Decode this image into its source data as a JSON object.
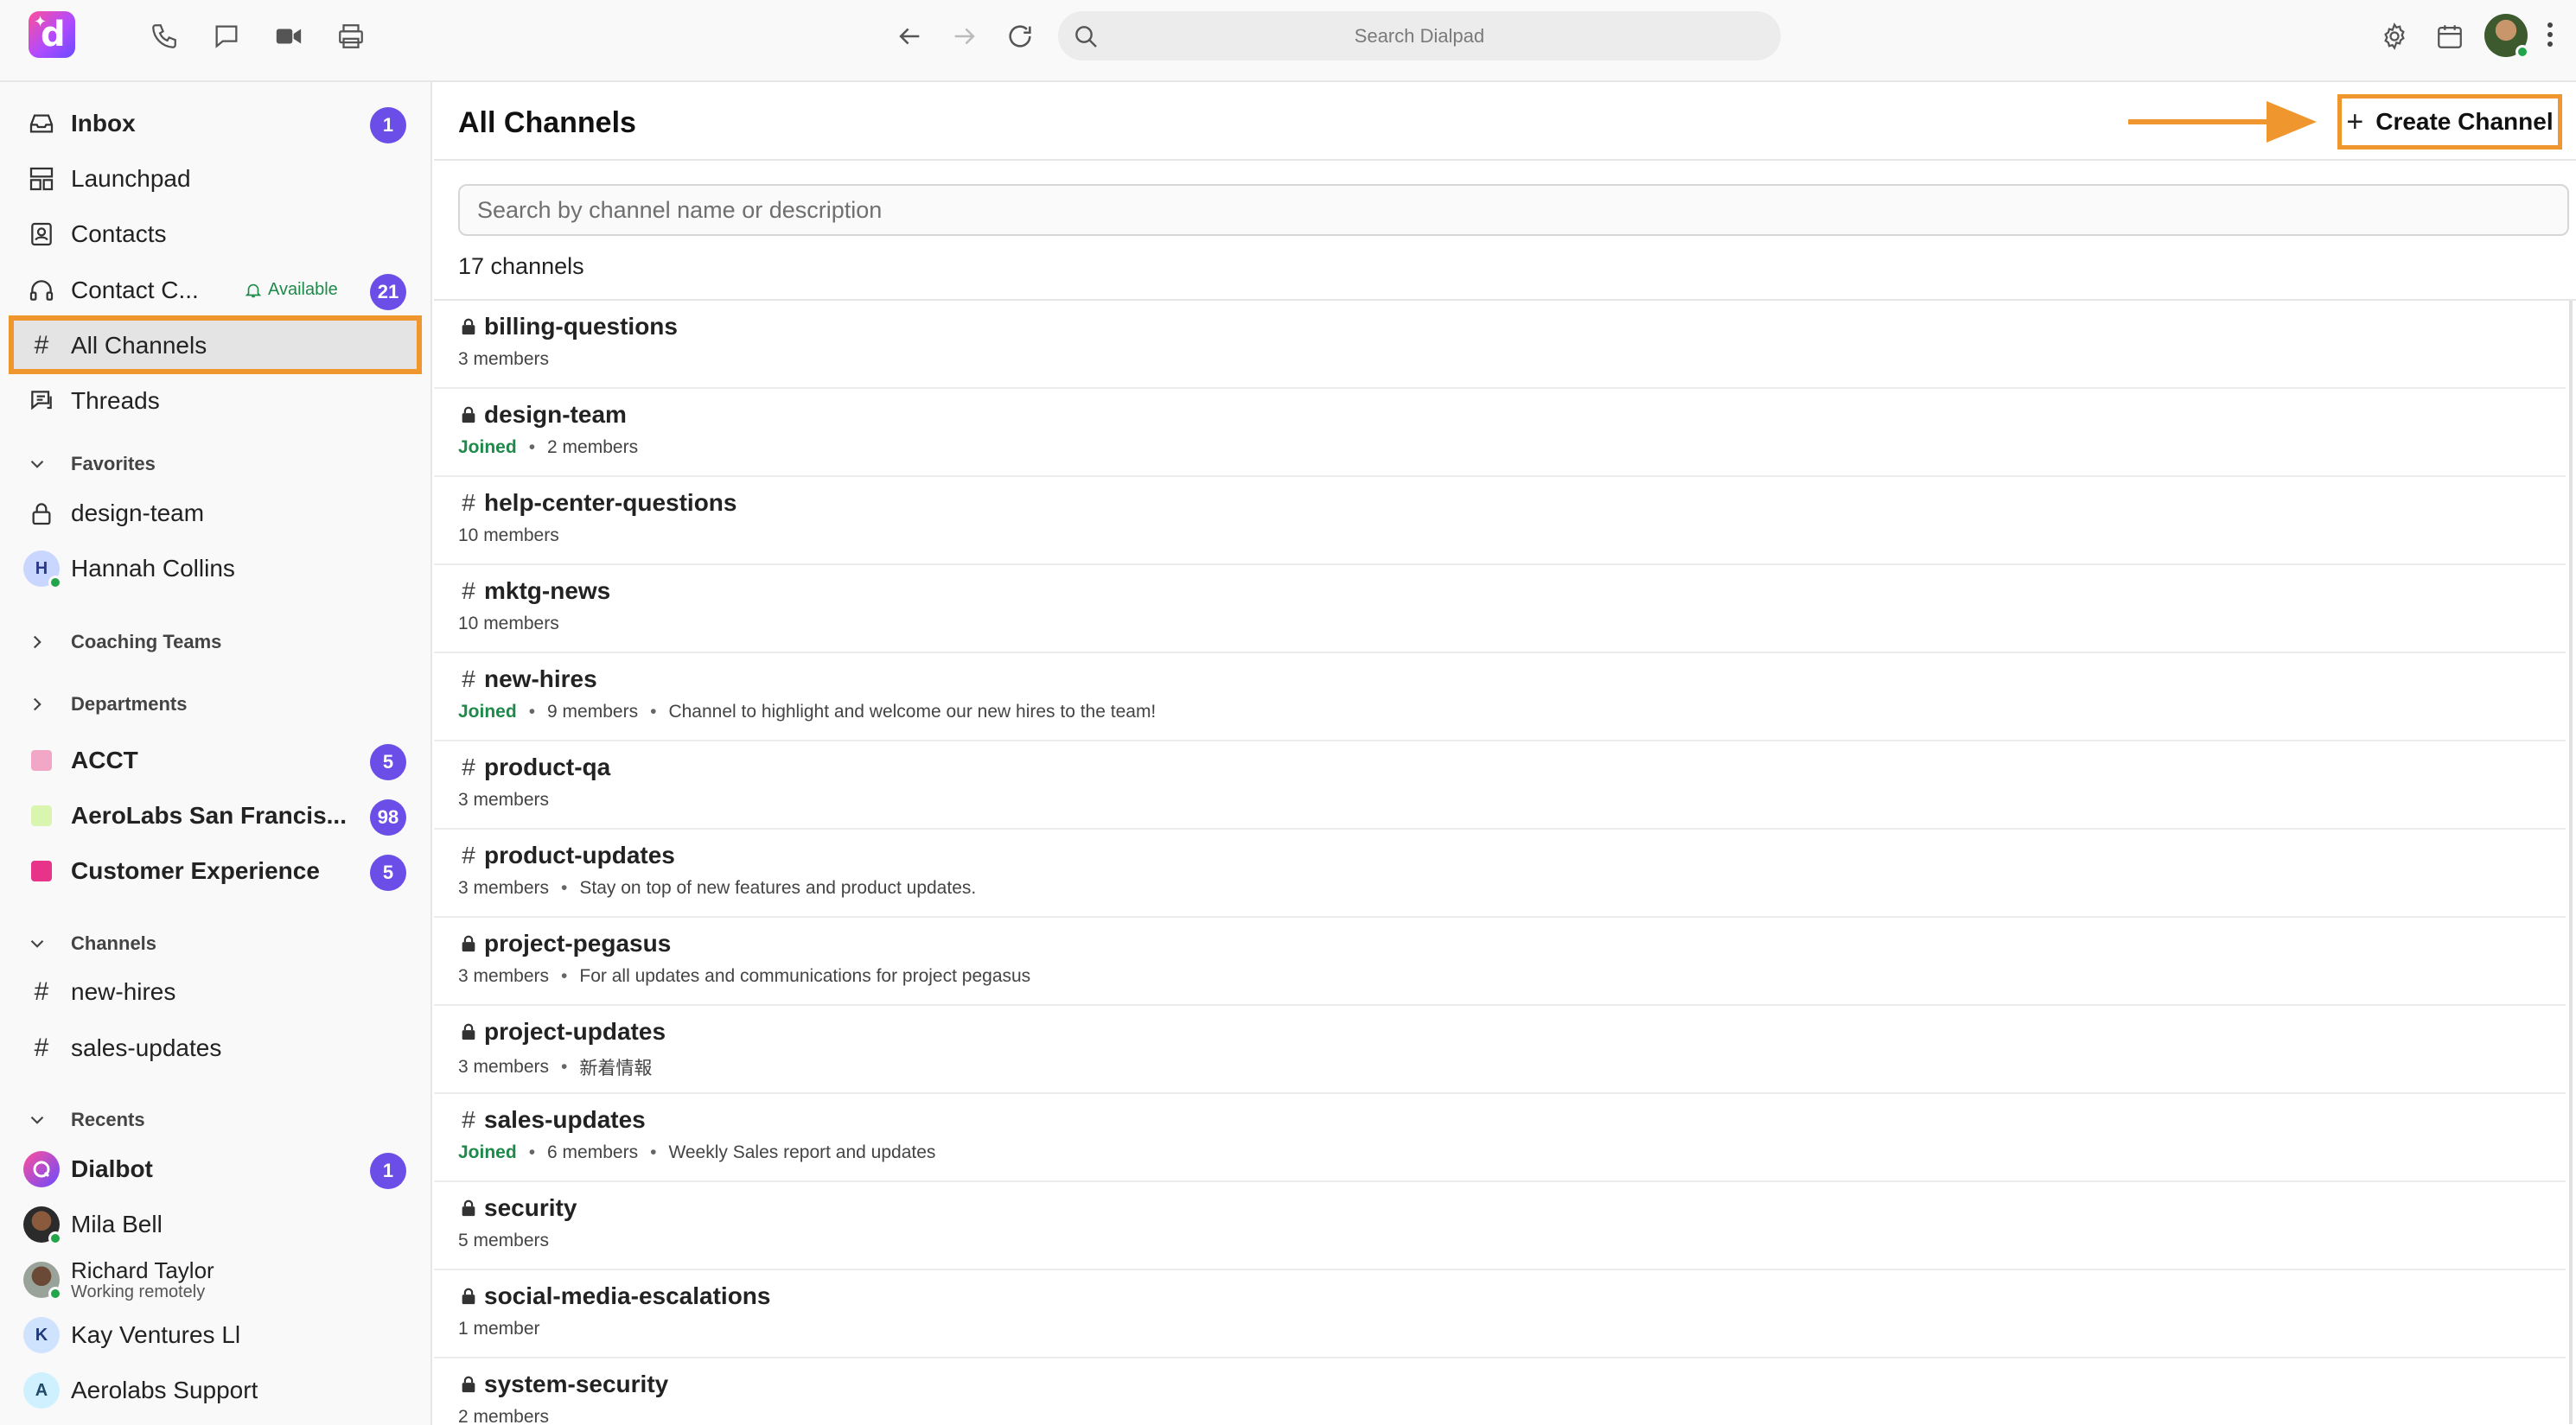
{
  "topbar": {
    "search_placeholder": "Search Dialpad",
    "logo_letter": "d"
  },
  "sidebar": {
    "inbox": {
      "label": "Inbox",
      "badge": "1"
    },
    "launchpad": {
      "label": "Launchpad"
    },
    "contacts": {
      "label": "Contacts"
    },
    "contact_center": {
      "label": "Contact C...",
      "status": "Available",
      "badge": "21"
    },
    "all_channels": {
      "label": "All Channels"
    },
    "threads": {
      "label": "Threads"
    },
    "favorites": {
      "heading": "Favorites",
      "items": [
        {
          "label": "design-team"
        },
        {
          "label": "Hannah Collins",
          "initial": "H"
        }
      ]
    },
    "coaching_teams": {
      "heading": "Coaching Teams"
    },
    "departments": {
      "heading": "Departments",
      "items": [
        {
          "label": "ACCT",
          "badge": "5",
          "color": "#f2a7c6"
        },
        {
          "label": "AeroLabs San Francis...",
          "badge": "98",
          "color": "#d9f5b0"
        },
        {
          "label": "Customer Experience",
          "badge": "5",
          "color": "#e8338a"
        }
      ]
    },
    "channels": {
      "heading": "Channels",
      "items": [
        {
          "label": "new-hires"
        },
        {
          "label": "sales-updates"
        }
      ]
    },
    "recents": {
      "heading": "Recents",
      "items": [
        {
          "label": "Dialbot",
          "badge": "1"
        },
        {
          "label": "Mila Bell"
        },
        {
          "label": "Richard Taylor",
          "sublabel": "Working remotely"
        },
        {
          "label": "Kay Ventures Ll",
          "initial": "K"
        },
        {
          "label": "Aerolabs Support",
          "initial": "A"
        }
      ]
    }
  },
  "main": {
    "title": "All Channels",
    "create_label": "Create Channel",
    "search_placeholder": "Search by channel name or description",
    "count_label": "17 channels",
    "channels": [
      {
        "name": "billing-questions",
        "private": true,
        "joined": false,
        "members": "3 members",
        "description": ""
      },
      {
        "name": "design-team",
        "private": true,
        "joined": true,
        "members": "2 members",
        "description": ""
      },
      {
        "name": "help-center-questions",
        "private": false,
        "joined": false,
        "members": "10 members",
        "description": ""
      },
      {
        "name": "mktg-news",
        "private": false,
        "joined": false,
        "members": "10 members",
        "description": ""
      },
      {
        "name": "new-hires",
        "private": false,
        "joined": true,
        "members": "9 members",
        "description": "Channel to highlight and welcome our new hires to the team!"
      },
      {
        "name": "product-qa",
        "private": false,
        "joined": false,
        "members": "3 members",
        "description": ""
      },
      {
        "name": "product-updates",
        "private": false,
        "joined": false,
        "members": "3 members",
        "description": "Stay on top of new features and product updates."
      },
      {
        "name": "project-pegasus",
        "private": true,
        "joined": false,
        "members": "3 members",
        "description": "For all updates and communications for project pegasus"
      },
      {
        "name": "project-updates",
        "private": true,
        "joined": false,
        "members": "3 members",
        "description": "新着情報"
      },
      {
        "name": "sales-updates",
        "private": false,
        "joined": true,
        "members": "6 members",
        "description": "Weekly Sales report and updates"
      },
      {
        "name": "security",
        "private": true,
        "joined": false,
        "members": "5 members",
        "description": ""
      },
      {
        "name": "social-media-escalations",
        "private": true,
        "joined": false,
        "members": "1 member",
        "description": ""
      },
      {
        "name": "system-security",
        "private": true,
        "joined": false,
        "members": "2 members",
        "description": ""
      }
    ],
    "joined_label": "Joined"
  },
  "colors": {
    "accent": "#6b4ee8",
    "highlight": "#f0962e",
    "joined": "#1e8a4a"
  }
}
